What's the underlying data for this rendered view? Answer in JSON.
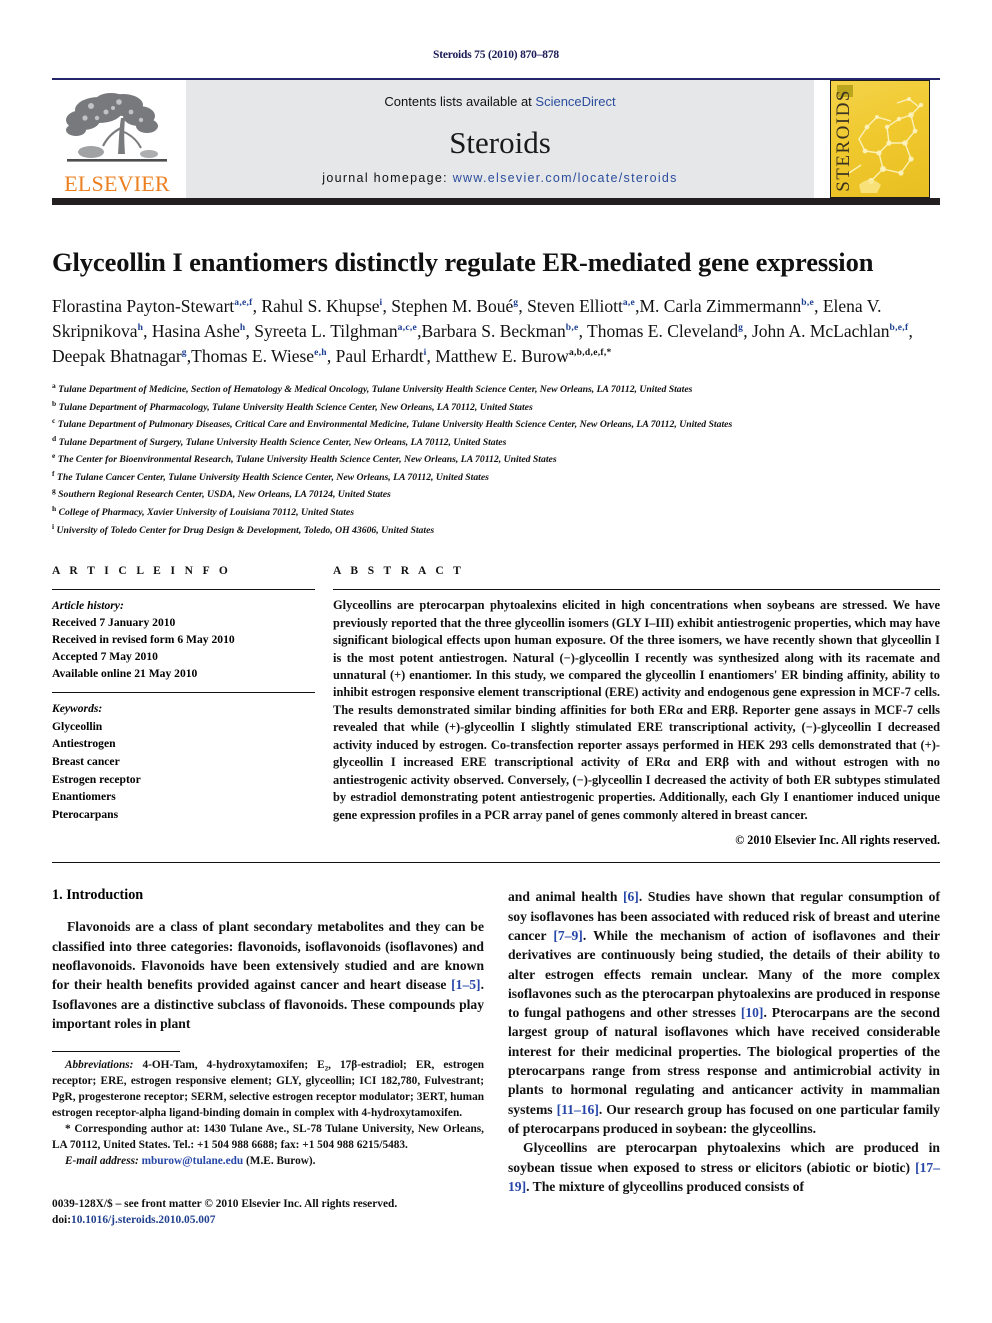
{
  "running_head": "Steroids 75 (2010) 870–878",
  "masthead": {
    "contents_prefix": "Contents lists available at ",
    "contents_link": "ScienceDirect",
    "journal_title": "Steroids",
    "homepage_label": "journal homepage:",
    "homepage_url": "www.elsevier.com/locate/steroids",
    "publisher": "ELSEVIER",
    "cover_text": "STEROIDS",
    "brand_orange": "#ec8021",
    "link_blue": "#2b4d9e",
    "rule_navy": "#25256b",
    "cover_yellow": "#f0c92f"
  },
  "article": {
    "title": "Glyceollin I enantiomers distinctly regulate ER-mediated gene expression",
    "authors": [
      {
        "name": "Florastina Payton-Stewart",
        "sup": "a,e,f",
        "sep": ", "
      },
      {
        "name": "Rahul S. Khupse",
        "sup": "i",
        "sep": ", "
      },
      {
        "name": "Stephen M. Boué",
        "sup": "g",
        "sep": ", "
      },
      {
        "name": "Steven Elliott",
        "sup": "a,e",
        "sep": ","
      },
      {
        "name": "M. Carla Zimmermann",
        "sup": "b,e",
        "sep": ", "
      },
      {
        "name": "Elena V. Skripnikova",
        "sup": "h",
        "sep": ", "
      },
      {
        "name": "Hasina Ashe",
        "sup": "h",
        "sep": ", "
      },
      {
        "name": "Syreeta L. Tilghman",
        "sup": "a,c,e",
        "sep": ","
      },
      {
        "name": "Barbara S. Beckman",
        "sup": "b,e",
        "sep": ", "
      },
      {
        "name": "Thomas E. Cleveland",
        "sup": "g",
        "sep": ", "
      },
      {
        "name": "John A. McLachlan",
        "sup": "b,e,f",
        "sep": ", "
      },
      {
        "name": "Deepak Bhatnagar",
        "sup": "g",
        "sep": ","
      },
      {
        "name": "Thomas E. Wiese",
        "sup": "e,h",
        "sep": ", "
      },
      {
        "name": "Paul Erhardt",
        "sup": "i",
        "sep": ", "
      },
      {
        "name": "Matthew E. Burow",
        "sup": "a,b,d,e,f,*",
        "sep": ""
      }
    ],
    "affiliations": [
      {
        "mark": "a",
        "text": "Tulane Department of Medicine, Section of Hematology & Medical Oncology, Tulane University Health Science Center, New Orleans, LA 70112, United States"
      },
      {
        "mark": "b",
        "text": "Tulane Department of Pharmacology, Tulane University Health Science Center, New Orleans, LA 70112, United States"
      },
      {
        "mark": "c",
        "text": "Tulane Department of Pulmonary Diseases, Critical Care and Environmental Medicine, Tulane University Health Science Center, New Orleans, LA 70112, United States"
      },
      {
        "mark": "d",
        "text": "Tulane Department of Surgery, Tulane University Health Science Center, New Orleans, LA 70112, United States"
      },
      {
        "mark": "e",
        "text": "The Center for Bioenvironmental Research, Tulane University Health Science Center, New Orleans, LA 70112, United States"
      },
      {
        "mark": "f",
        "text": "The Tulane Cancer Center, Tulane University Health Science Center, New Orleans, LA 70112, United States"
      },
      {
        "mark": "g",
        "text": "Southern Regional Research Center, USDA, New Orleans, LA 70124, United States"
      },
      {
        "mark": "h",
        "text": "College of Pharmacy, Xavier University of Louisiana 70112, United States"
      },
      {
        "mark": "i",
        "text": "University of Toledo Center for Drug Design & Development, Toledo, OH 43606, United States"
      }
    ]
  },
  "article_info": {
    "heading": "A R T I C L E   I N F O",
    "history_label": "Article history:",
    "history": [
      "Received 7 January 2010",
      "Received in revised form 6 May 2010",
      "Accepted 7 May 2010",
      "Available online 21 May 2010"
    ],
    "keywords_label": "Keywords:",
    "keywords": [
      "Glyceollin",
      "Antiestrogen",
      "Breast cancer",
      "Estrogen receptor",
      "Enantiomers",
      "Pterocarpans"
    ]
  },
  "abstract": {
    "heading": "A B S T R A C T",
    "text": "Glyceollins are pterocarpan phytoalexins elicited in high concentrations when soybeans are stressed. We have previously reported that the three glyceollin isomers (GLY I–III) exhibit antiestrogenic properties, which may have significant biological effects upon human exposure. Of the three isomers, we have recently shown that glyceollin I is the most potent antiestrogen. Natural (−)-glyceollin I recently was synthesized along with its racemate and unnatural (+) enantiomer. In this study, we compared the glyceollin I enantiomers' ER binding affinity, ability to inhibit estrogen responsive element transcriptional (ERE) activity and endogenous gene expression in MCF-7 cells. The results demonstrated similar binding affinities for both ERα and ERβ. Reporter gene assays in MCF-7 cells revealed that while (+)-glyceollin I slightly stimulated ERE transcriptional activity, (−)-glyceollin I decreased activity induced by estrogen. Co-transfection reporter assays performed in HEK 293 cells demonstrated that (+)-glyceollin I increased ERE transcriptional activity of ERα and ERβ with and without estrogen with no antiestrogenic activity observed. Conversely, (−)-glyceollin I decreased the activity of both ER subtypes stimulated by estradiol demonstrating potent antiestrogenic properties. Additionally, each Gly I enantiomer induced unique gene expression profiles in a PCR array panel of genes commonly altered in breast cancer.",
    "copyright": "© 2010 Elsevier Inc. All rights reserved."
  },
  "introduction": {
    "heading": "1. Introduction",
    "left_para1_a": "Flavonoids are a class of plant secondary metabolites and they can be classified into three categories: flavonoids, isoflavonoids (isoflavones) and neoflavonoids. Flavonoids have been extensively studied and are known for their health benefits provided against cancer and heart disease ",
    "left_ref1": "[1–5]",
    "left_para1_b": ". Isoflavones are a distinctive subclass of flavonoids. These compounds play important roles in plant",
    "right_para1_a": "and animal health ",
    "right_ref1": "[6]",
    "right_para1_b": ". Studies have shown that regular consumption of soy isoflavones has been associated with reduced risk of breast and uterine cancer ",
    "right_ref2": "[7–9]",
    "right_para1_c": ". While the mechanism of action of isoflavones and their derivatives are continuously being studied, the details of their ability to alter estrogen effects remain unclear. Many of the more complex isoflavones such as the pterocarpan phytoalexins are produced in response to fungal pathogens and other stresses ",
    "right_ref3": "[10]",
    "right_para1_d": ". Pterocarpans are the second largest group of natural isoflavones which have received considerable interest for their medicinal properties. The biological properties of the pterocarpans range from stress response and antimicrobial activity in plants to hormonal regulating and anticancer activity in mammalian systems ",
    "right_ref4": "[11–16]",
    "right_para1_e": ". Our research group has focused on one particular family of pterocarpans produced in soybean: the glyceollins.",
    "right_para2_a": "Glyceollins are pterocarpan phytoalexins which are produced in soybean tissue when exposed to stress or elicitors (abiotic or biotic) ",
    "right_ref5": "[17–19]",
    "right_para2_b": ". The mixture of glyceollins produced consists of"
  },
  "footnotes": {
    "abbrev_label": "Abbreviations:",
    "abbrev_text": " 4-OH-Tam, 4-hydroxytamoxifen; E₂, 17β-estradiol; ER, estrogen receptor; ERE, estrogen responsive element; GLY, glyceollin; ICI 182,780, Fulvestrant; PgR, progesterone receptor; SERM, selective estrogen receptor modulator; 3ERT, human estrogen receptor-alpha ligand-binding domain in complex with 4-hydroxytamoxifen.",
    "corresponding": "* Corresponding author at: 1430 Tulane Ave., SL-78 Tulane University, New Orleans, LA 70112, United States. Tel.: +1 504 988 6688; fax: +1 504 988 6215/5483.",
    "email_label": "E-mail address:",
    "email": "mburow@tulane.edu",
    "email_suffix": " (M.E. Burow)."
  },
  "imprint": {
    "line1": "0039-128X/$ – see front matter © 2010 Elsevier Inc. All rights reserved.",
    "doi_label": "doi:",
    "doi": "10.1016/j.steroids.2010.05.007"
  }
}
